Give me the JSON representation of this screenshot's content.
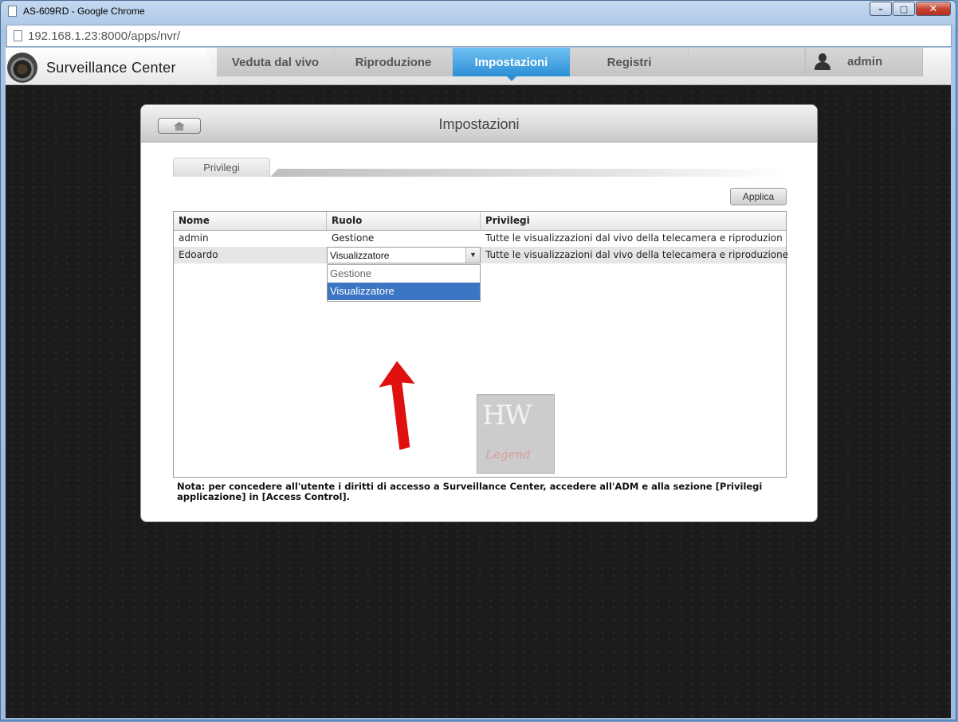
{
  "window": {
    "title": "AS-609RD - Google Chrome",
    "url": "192.168.1.23:8000/apps/nvr/",
    "buttons": {
      "minimize": "–",
      "maximize": "□",
      "close": "✕"
    }
  },
  "app": {
    "brand": "Surveillance Center",
    "nav_tabs": [
      {
        "label": "Veduta dal vivo",
        "active": false
      },
      {
        "label": "Riproduzione",
        "active": false
      },
      {
        "label": "Impostazioni",
        "active": true
      },
      {
        "label": "Registri",
        "active": false
      },
      {
        "label": "",
        "active": false
      }
    ],
    "user": "admin"
  },
  "panel": {
    "title": "Impostazioni",
    "subtab": "Privilegi",
    "apply_label": "Applica",
    "columns": [
      "Nome",
      "Ruolo",
      "Privilegi"
    ],
    "rows": [
      {
        "name": "admin",
        "role": "Gestione",
        "privileges": "Tutte le visualizzazioni dal vivo della telecamera e riproduzion..."
      },
      {
        "name": "Edoardo",
        "role": "Visualizzatore",
        "privileges": "Tutte le visualizzazioni dal vivo della telecamera e riproduzione"
      }
    ],
    "dropdown_options": [
      "Gestione",
      "Visualizzatore"
    ],
    "dropdown_selected": "Visualizzatore",
    "note": "Nota: per concedere all'utente i diritti di accesso a Surveillance Center, accedere all'ADM e alla sezione [Privilegi applicazione] in [Access Control]."
  },
  "watermark": {
    "top": "HW",
    "bottom": "Legend"
  },
  "colors": {
    "active_tab": "#3a9ae0",
    "selected_option": "#3b76c4",
    "annotation_arrow": "#e01010"
  }
}
